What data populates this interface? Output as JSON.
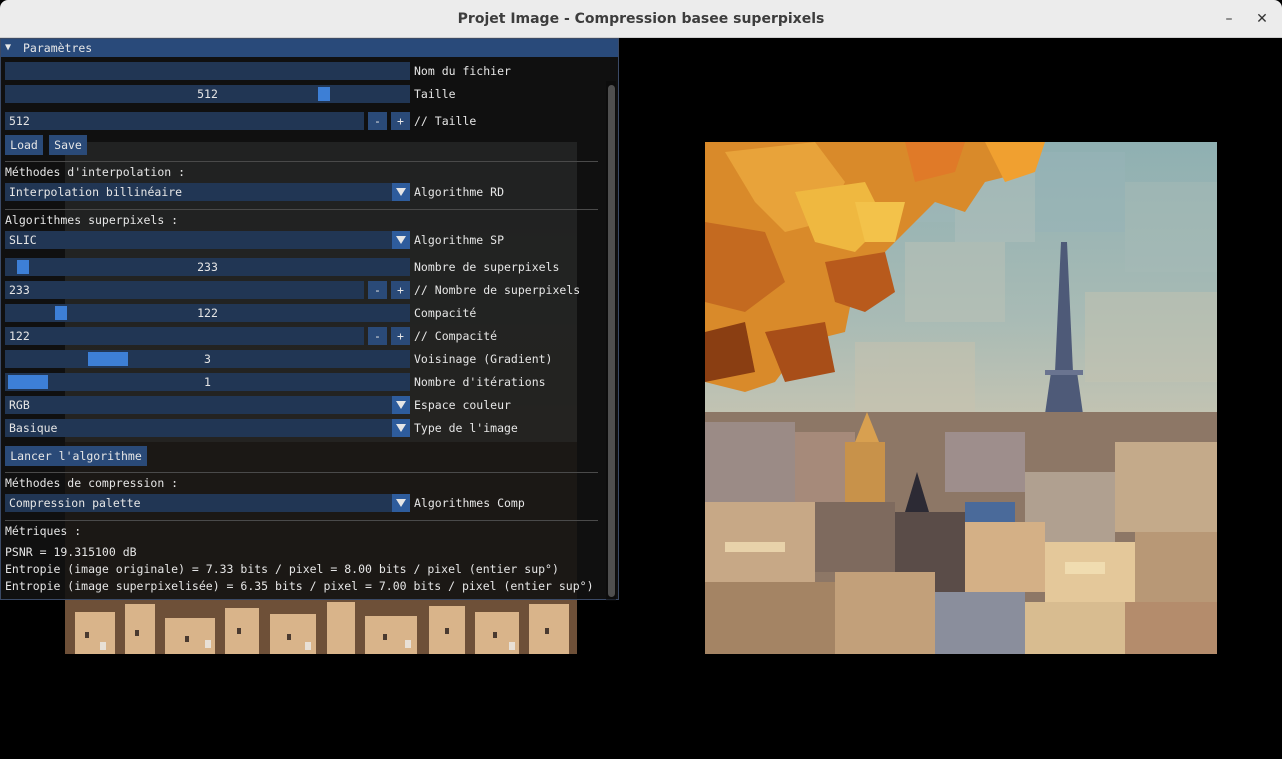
{
  "window": {
    "title": "Projet Image - Compression basee superpixels",
    "minimize_label": "–",
    "close_label": "✕"
  },
  "panel": {
    "header": "Paramètres",
    "filename": {
      "value": "",
      "label": "Nom du fichier"
    },
    "size_slider": {
      "value": "512",
      "label": "Taille",
      "fraction": 0.78
    },
    "size_input": {
      "value": "512",
      "label": "// Taille"
    },
    "minus": "-",
    "plus": "+",
    "load_button": "Load",
    "save_button": "Save",
    "interp": {
      "section": "Méthodes d'interpolation :",
      "value": "Interpolation billinéaire",
      "label": "Algorithme RD"
    },
    "superpixels": {
      "section": "Algorithmes superpixels :",
      "algo": {
        "value": "SLIC",
        "label": "Algorithme SP"
      },
      "count_slider": {
        "value": "233",
        "label": "Nombre de superpixels",
        "fraction": 0.04
      },
      "count_input": {
        "value": "233",
        "label": "// Nombre de superpixels"
      },
      "compactness_slider": {
        "value": "122",
        "label": "Compacité",
        "fraction": 0.13
      },
      "compactness_input": {
        "value": "122",
        "label": "// Compacité"
      },
      "neighborhood_slider": {
        "value": "3",
        "label": "Voisinage (Gradient)",
        "fraction": 0.2
      },
      "iterations_slider": {
        "value": "1",
        "label": "Nombre d'itérations",
        "fraction": 0.0
      },
      "colorspace": {
        "value": "RGB",
        "label": "Espace couleur"
      },
      "image_type": {
        "value": "Basique",
        "label": "Type de l'image"
      },
      "run_button": "Lancer l'algorithme"
    },
    "compression": {
      "section": "Méthodes de compression :",
      "value": "Compression palette",
      "label": "Algorithmes Comp"
    },
    "metrics": {
      "section": "Métriques :",
      "psnr": "PSNR = 19.315100 dB",
      "entropy_original": "Entropie (image originale) = 7.33 bits / pixel = 8.00 bits / pixel (entier sup°)",
      "entropy_superpixel": "Entropie (image superpixelisée) = 6.35 bits / pixel = 7.00 bits / pixel (entier sup°)"
    }
  }
}
